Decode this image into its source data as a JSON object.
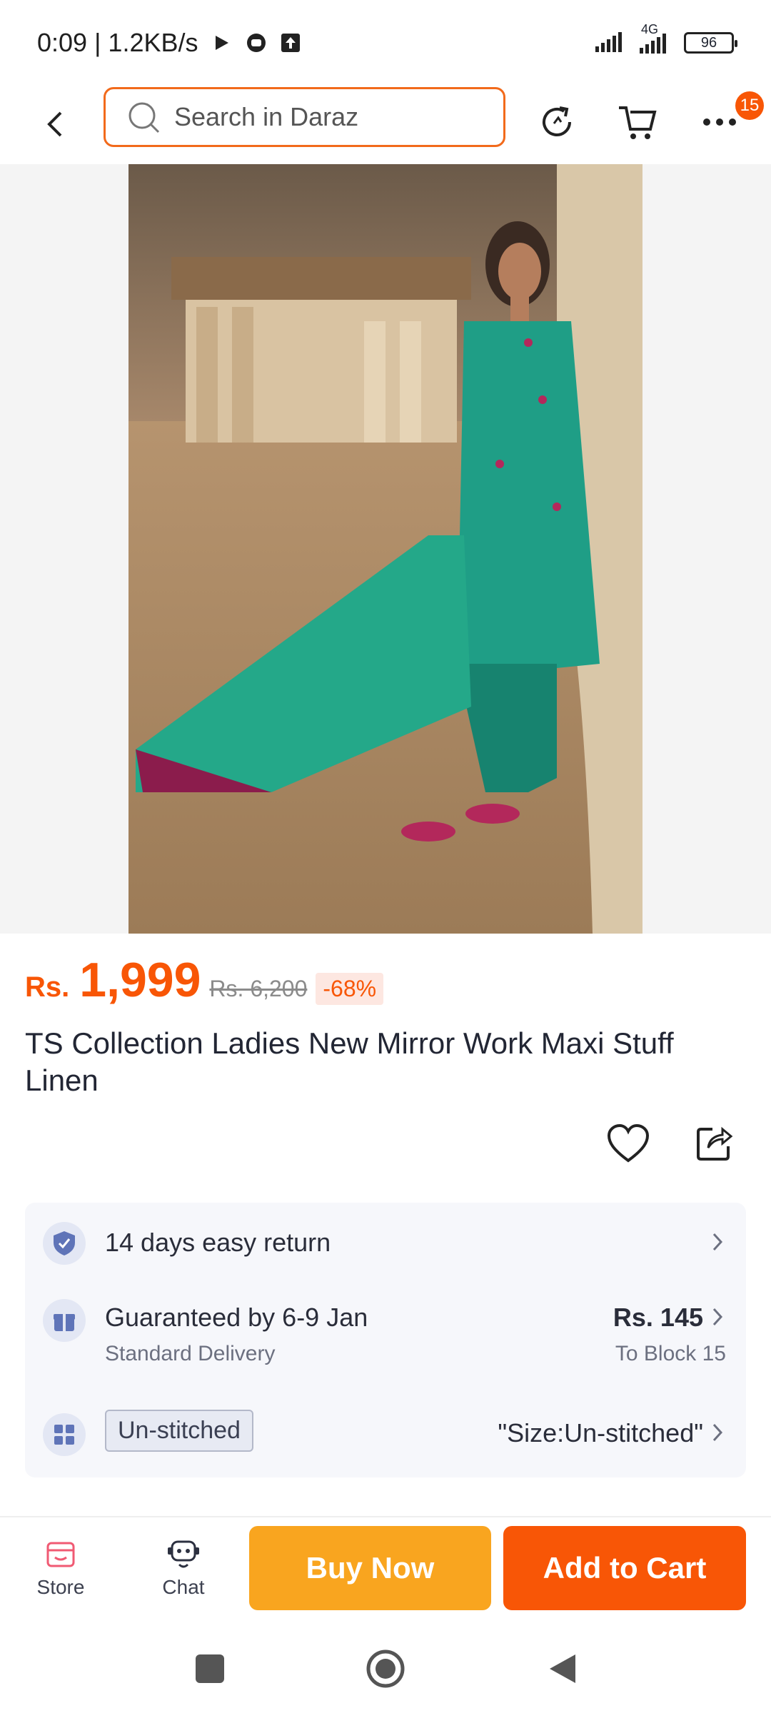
{
  "status_bar": {
    "time_speed": "0:09 | 1.2KB/s",
    "network": "4G",
    "battery": "96"
  },
  "top_nav": {
    "search_placeholder": "Search in Daraz",
    "badge_count": "15",
    "icons": [
      "back-arrow-icon",
      "search-icon",
      "refresh-icon",
      "cart-icon",
      "more-icon"
    ]
  },
  "product": {
    "currency": "Rs.",
    "price": "1,999",
    "old_price": "Rs. 6,200",
    "discount": "-68%",
    "title": "TS Collection Ladies New Mirror Work Maxi Stuff Linen"
  },
  "info": {
    "return_text": "14 days easy return",
    "delivery_text": "Guaranteed by 6-9 Jan",
    "delivery_sub": "Standard Delivery",
    "delivery_price": "Rs. 145",
    "delivery_location": "To Block 15",
    "variant_tag": "Un-stitched",
    "variant_value": "\"Size:Un-stitched\""
  },
  "actions": {
    "store_label": "Store",
    "chat_label": "Chat",
    "buy_now_label": "Buy Now",
    "add_to_cart_label": "Add to Cart"
  },
  "colors": {
    "brand_orange": "#f85606",
    "buy_now_yellow": "#f9a51f",
    "icon_blue": "#5f74b8"
  }
}
